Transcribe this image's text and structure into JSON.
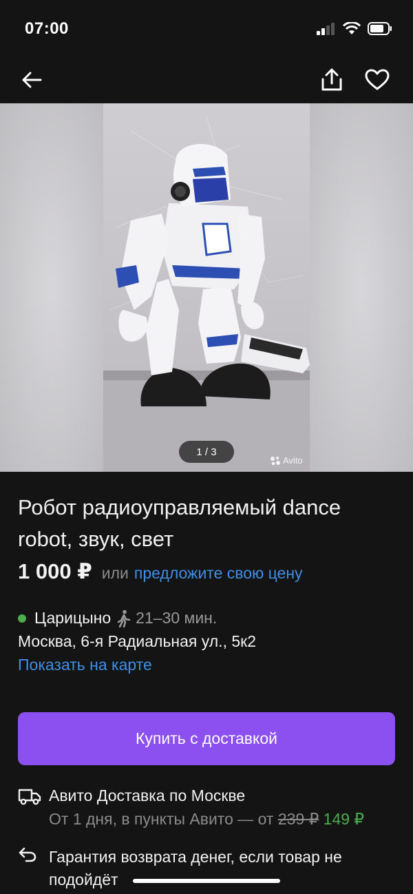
{
  "status": {
    "time": "07:00"
  },
  "gallery": {
    "counter": "1 / 3",
    "watermark": "Avito"
  },
  "listing": {
    "title": "Робот радиоуправляемый dance robot, звук, свет",
    "price": "1 000 ₽",
    "price_or": "или",
    "price_offer": "предложите свою цену"
  },
  "location": {
    "metro": "Царицыно",
    "metro_color": "#4cae4c",
    "walk_time": "21–30 мин.",
    "address": "Москва, 6-я Радиальная ул., 5к2",
    "map_link": "Показать на карте"
  },
  "actions": {
    "buy_label": "Купить с доставкой",
    "buy_color": "#8c4ff0"
  },
  "delivery": {
    "title": "Авито Доставка по Москве",
    "subtitle": "От 1 дня, в пункты Авито — от",
    "old_price": "239 ₽",
    "new_price": "149 ₽"
  },
  "guarantee": {
    "text": "Гарантия возврата денег, если товар не подойдёт"
  },
  "icons": [
    "back-arrow-icon",
    "share-icon",
    "heart-icon",
    "walk-icon",
    "truck-icon",
    "return-arrow-icon"
  ]
}
